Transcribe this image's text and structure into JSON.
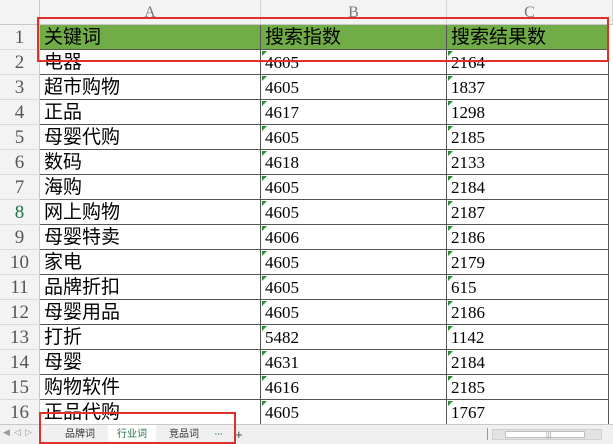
{
  "columns": [
    "A",
    "B",
    "C"
  ],
  "header": {
    "row_number": "1",
    "keyword": "关键词",
    "search_index": "搜索指数",
    "search_results": "搜索结果数"
  },
  "active_row": "8",
  "rows": [
    {
      "n": "2",
      "keyword": "电器",
      "index": "4605",
      "results": "2164"
    },
    {
      "n": "3",
      "keyword": "超市购物",
      "index": "4605",
      "results": "1837"
    },
    {
      "n": "4",
      "keyword": "正品",
      "index": "4617",
      "results": "1298"
    },
    {
      "n": "5",
      "keyword": "母婴代购",
      "index": "4605",
      "results": "2185"
    },
    {
      "n": "6",
      "keyword": "数码",
      "index": "4618",
      "results": "2133"
    },
    {
      "n": "7",
      "keyword": "海购",
      "index": "4605",
      "results": "2184"
    },
    {
      "n": "8",
      "keyword": "网上购物",
      "index": "4605",
      "results": "2187"
    },
    {
      "n": "9",
      "keyword": "母婴特卖",
      "index": "4606",
      "results": "2186"
    },
    {
      "n": "10",
      "keyword": "家电",
      "index": "4605",
      "results": "2179"
    },
    {
      "n": "11",
      "keyword": "品牌折扣",
      "index": "4605",
      "results": "615"
    },
    {
      "n": "12",
      "keyword": "母婴用品",
      "index": "4605",
      "results": "2186"
    },
    {
      "n": "13",
      "keyword": "打折",
      "index": "5482",
      "results": "1142"
    },
    {
      "n": "14",
      "keyword": "母婴",
      "index": "4631",
      "results": "2184"
    },
    {
      "n": "15",
      "keyword": "购物软件",
      "index": "4616",
      "results": "2185"
    },
    {
      "n": "16",
      "keyword": "正品代购",
      "index": "4605",
      "results": "1767"
    }
  ],
  "sheet_tabs": [
    {
      "label": "品牌词",
      "active": false
    },
    {
      "label": "行业词",
      "active": true
    },
    {
      "label": "竞品词",
      "active": false
    }
  ],
  "more_tabs_label": "···",
  "add_sheet_label": "+",
  "colors": {
    "header_fill": "#70ad47",
    "highlight_border": "#e0302a",
    "accent": "#217346"
  }
}
